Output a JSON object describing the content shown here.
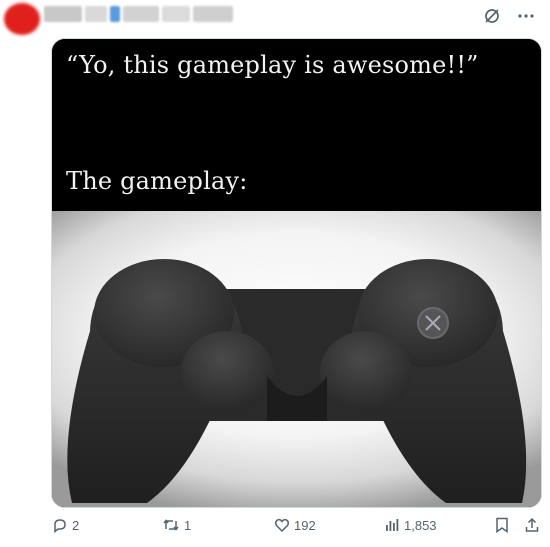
{
  "post": {
    "caption_top": "“Yo, this gameplay is awesome!!”",
    "caption_bottom": "The gameplay:"
  },
  "header": {
    "avatar_color": "#e0201c",
    "icons": [
      "grok-slash-icon",
      "more-icon"
    ]
  },
  "actions": {
    "replies": "2",
    "reposts": "1",
    "likes": "192",
    "views": "1,853"
  },
  "colors": {
    "action_gray": "#536471",
    "controller": "#2b2b2b"
  }
}
